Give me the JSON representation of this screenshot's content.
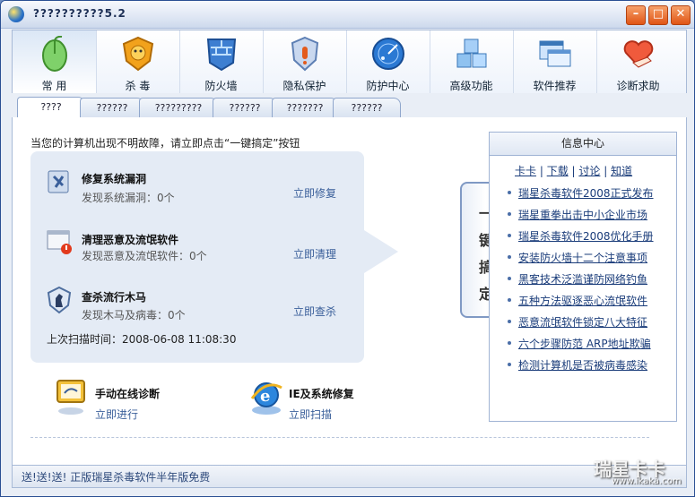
{
  "window": {
    "title": "??????????5.2",
    "btn_min": "–",
    "btn_max": "□",
    "btn_close": "✕"
  },
  "toolbar": [
    {
      "label": "常 用",
      "icon": "mouse-icon"
    },
    {
      "label": "杀 毒",
      "icon": "lion-shield-icon"
    },
    {
      "label": "防火墙",
      "icon": "firewall-icon"
    },
    {
      "label": "隐私保护",
      "icon": "privacy-shield-icon"
    },
    {
      "label": "防护中心",
      "icon": "radar-icon"
    },
    {
      "label": "高级功能",
      "icon": "cubes-icon"
    },
    {
      "label": "软件推荐",
      "icon": "windows-icon"
    },
    {
      "label": "诊断求助",
      "icon": "heart-hand-icon"
    }
  ],
  "tabs": [
    "????",
    "??????",
    "?????????",
    "??????",
    "???????",
    "??????"
  ],
  "main": {
    "hint": "当您的计算机出现不明故障，请立即点击“一键搞定”按钮",
    "items": [
      {
        "title": "修复系统漏洞",
        "sub": "发现系统漏洞：0个",
        "action": "立即修复"
      },
      {
        "title": "清理恶意及流氓软件",
        "sub": "发现恶意及流氓软件：0个",
        "action": "立即清理"
      },
      {
        "title": "查杀流行木马",
        "sub": "发现木马及病毒：0个",
        "action": "立即查杀"
      }
    ],
    "scan_time": "上次扫描时间：2008-06-08 11:08:30",
    "onekey": [
      "一",
      "键",
      "搞",
      "定"
    ]
  },
  "info": {
    "title": "信息中心",
    "links": [
      "卡卡",
      "下载",
      "讨论",
      "知道"
    ],
    "news": [
      "瑞星杀毒软件2008正式发布",
      "瑞星重拳出击中小企业市场",
      "瑞星杀毒软件2008优化手册",
      "安装防火墙十二个注意事项",
      "黑客技术泛滥谨防网络钓鱼",
      "五种方法驱逐恶心流氓软件",
      "恶意流氓软件锁定八大特征",
      "六个步骤防范 ARP地址欺骗",
      "检测计算机是否被病毒感染"
    ]
  },
  "tools": [
    {
      "title": "手动在线诊断",
      "sub": "立即进行"
    },
    {
      "title": "IE及系统修复",
      "sub": "立即扫描"
    }
  ],
  "status": "送!送!送! 正版瑞星杀毒软件半年版免费",
  "watermark": {
    "brand": "瑞星卡卡",
    "url": "www.ikaka.com"
  }
}
